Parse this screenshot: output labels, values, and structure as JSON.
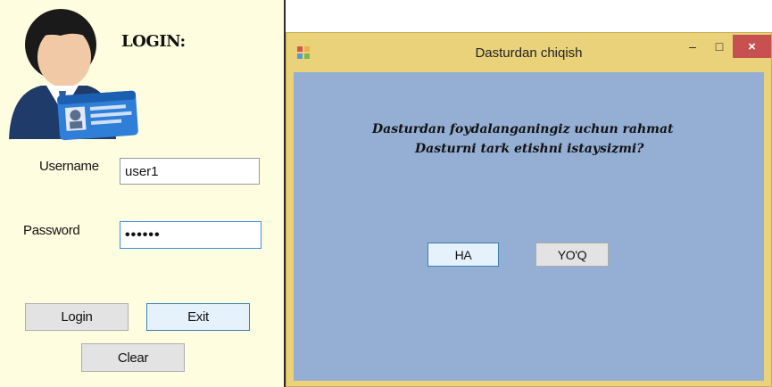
{
  "login_window": {
    "title": "LOGIN:",
    "username_label": "Username",
    "username_value": "user1",
    "password_label": "Password",
    "password_value": "••••••",
    "login_button": "Login",
    "exit_button": "Exit",
    "clear_button": "Clear",
    "avatar_icon": "user-id-card-icon"
  },
  "dialog": {
    "title": "Dasturdan chiqish",
    "app_icon": "form-icon",
    "minimize_icon": "minimize-icon",
    "maximize_icon": "maximize-icon",
    "close_icon": "close-icon",
    "message_line1": "Dasturdan foydalanganingiz uchun rahmat",
    "message_line2": "Dasturni tark etishni istaysizmi?",
    "yes_button": "HA",
    "no_button": "YO'Q",
    "close_glyph": "×",
    "minimize_glyph": "–",
    "maximize_glyph": "□"
  },
  "colors": {
    "login_bg": "#fffde0",
    "dialog_frame": "#e9d27a",
    "dialog_client": "#94aed4",
    "close_button": "#c75050"
  }
}
